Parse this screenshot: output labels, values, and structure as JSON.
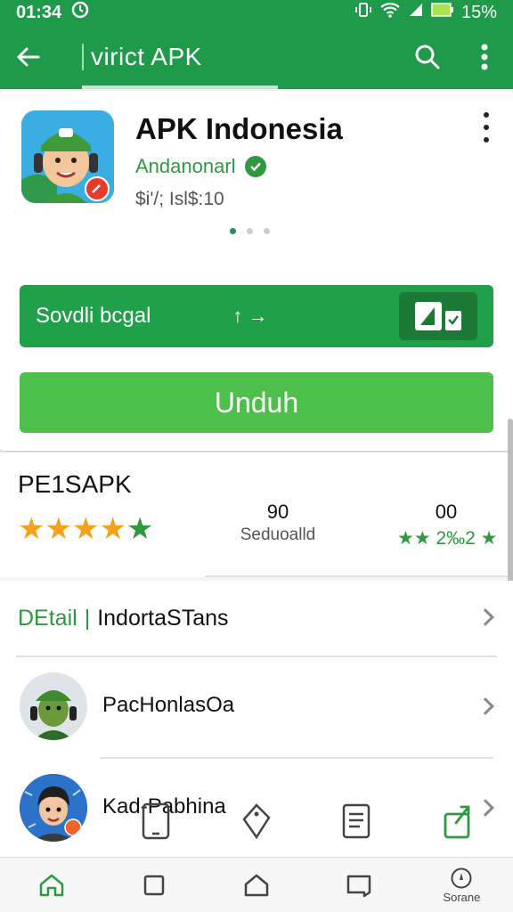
{
  "status_bar": {
    "time": "01:34",
    "battery": "15%"
  },
  "toolbar": {
    "title": "virict APK"
  },
  "app": {
    "name": "APK Indonesia",
    "developer": "Andanonarl",
    "meta": "$i'/; Isl$:10",
    "install_label": "Unduh",
    "promo_label": "Sovdli bcgal",
    "promo_arrow": "↑ →"
  },
  "rating": {
    "section_title": "PE1SAPK",
    "stat_1": {
      "value": "90",
      "label": "Seduoalld"
    },
    "stat_2": {
      "value": "00",
      "stars_text": "★★ 2‰2 ★"
    }
  },
  "list": {
    "detail_prefix": "DEtail",
    "detail_label": "IndortaSTans",
    "person_1": "PacHonlasOa",
    "person_2": "Kad-Pabhina"
  },
  "bottom_nav": {
    "last_label": "Sorane"
  },
  "colors": {
    "primary": "#1e9a4a",
    "install": "#4cc04a",
    "star": "#f5a11c",
    "accent": "#2e9a3f"
  }
}
